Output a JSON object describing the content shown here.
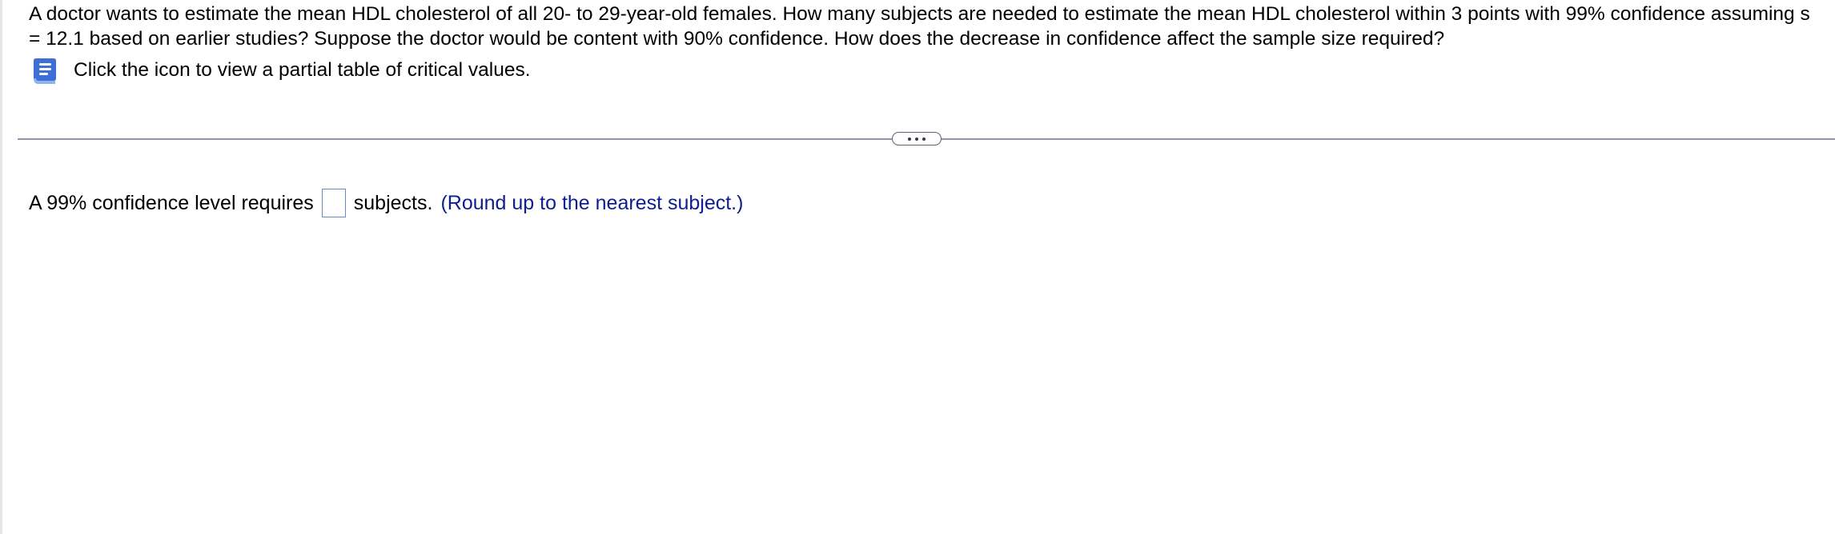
{
  "question": {
    "text": "A doctor wants to estimate the mean HDL cholesterol of all 20- to 29-year-old females. How many subjects are needed to estimate the mean HDL cholesterol within 3 points with 99% confidence assuming s = 12.1 based on earlier studies? Suppose the doctor would be content with 90% confidence. How does the decrease in confidence affect the sample size required?"
  },
  "hint": {
    "icon": "book-icon",
    "label": "Click the icon to view a partial table of critical values."
  },
  "divider": {
    "more_icon": "ellipsis-icon"
  },
  "answer": {
    "prefix": "A 99% confidence level requires",
    "value": "",
    "suffix": "subjects.",
    "note": "(Round up to the nearest subject.)"
  },
  "colors": {
    "note_text": "#0d1f8f",
    "icon_blue": "#3d6fd6",
    "input_border": "#6d86c6",
    "divider": "#9097a8"
  }
}
